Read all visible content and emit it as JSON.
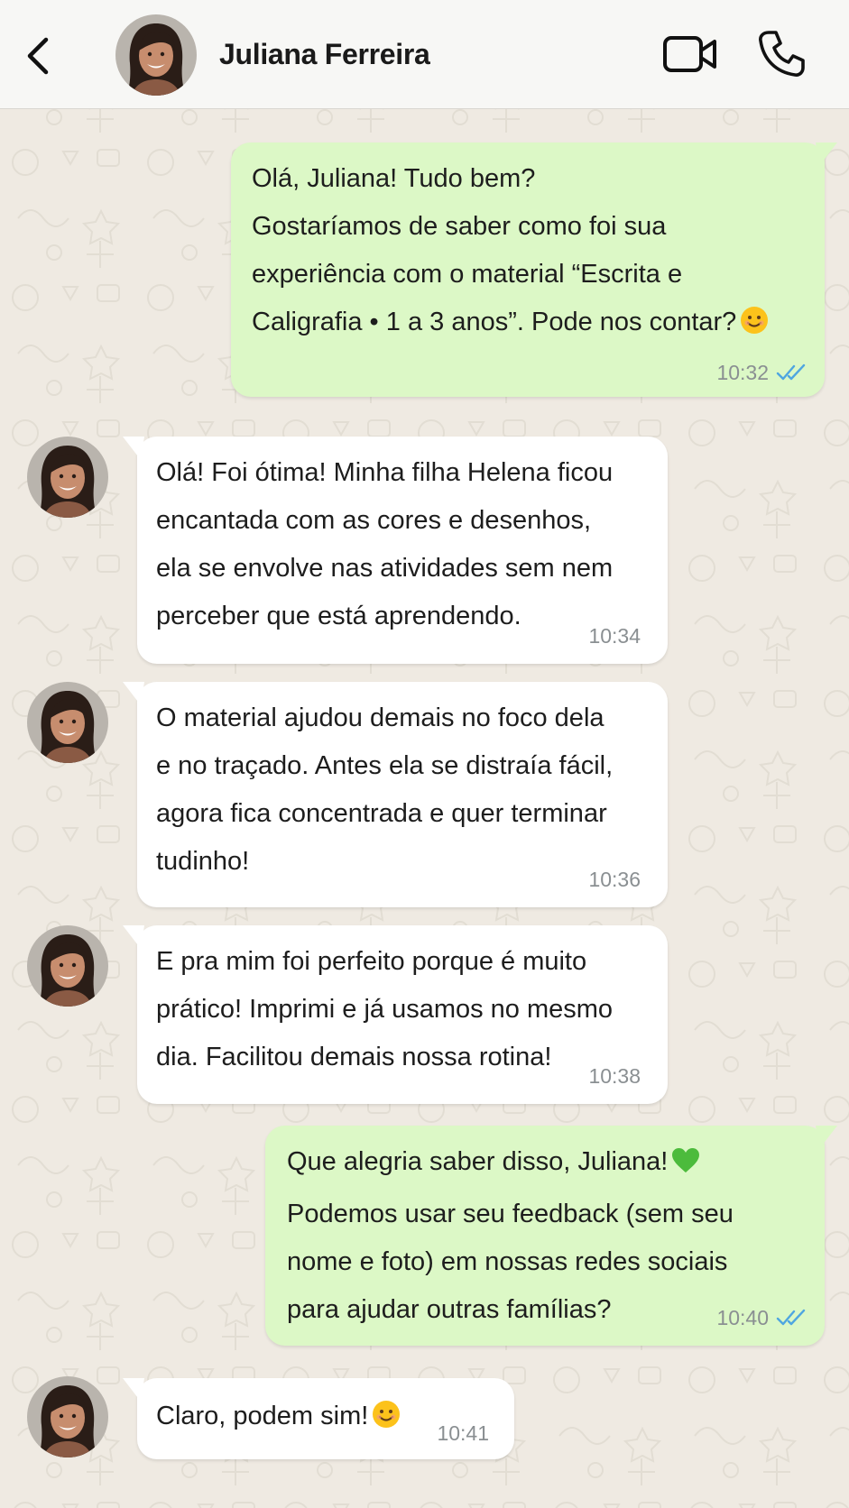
{
  "header": {
    "contact_name": "Juliana Ferreira"
  },
  "icons": {
    "back": "chevron-left-icon",
    "video": "video-camera-icon",
    "call": "phone-icon"
  },
  "colors": {
    "outgoing_bubble": "#dcf8c6",
    "incoming_bubble": "#ffffff",
    "chat_background": "#efeae2",
    "read_ticks": "#4fa6e0",
    "timestamp": "#8a8f92"
  },
  "messages": [
    {
      "direction": "outgoing",
      "lines": [
        "Olá, Juliana! Tudo bem?",
        "Gostaríamos de saber como foi sua",
        "experiência com o material “Escrita e",
        "Caligrafia • 1 a 3 anos”. Pode nos contar?"
      ],
      "emoji": "smiling-face",
      "time": "10:32",
      "status": "read"
    },
    {
      "direction": "incoming",
      "lines": [
        "Olá! Foi ótima! Minha filha Helena ficou",
        "encantada com as cores e desenhos,",
        "ela se envolve nas atividades sem nem",
        "perceber que está aprendendo."
      ],
      "time": "10:34"
    },
    {
      "direction": "incoming",
      "lines": [
        "O material ajudou demais no foco dela",
        "e no traçado. Antes ela se distraía fácil,",
        "agora fica concentrada e quer terminar",
        "tudinho!"
      ],
      "time": "10:36"
    },
    {
      "direction": "incoming",
      "lines": [
        "E pra mim foi perfeito porque é muito",
        "prático! Imprimi e já usamos no mesmo",
        "dia. Facilitou demais nossa rotina!"
      ],
      "time": "10:38"
    },
    {
      "direction": "outgoing",
      "lines": [
        "Que alegria saber disso, Juliana!",
        "Podemos usar seu feedback (sem seu",
        "nome e foto) em nossas redes sociais",
        "para ajudar outras famílias?"
      ],
      "emoji": "green-heart",
      "time": "10:40",
      "status": "read"
    },
    {
      "direction": "incoming",
      "lines": [
        "Claro, podem sim!"
      ],
      "emoji": "smiling-face",
      "time": "10:41"
    }
  ]
}
